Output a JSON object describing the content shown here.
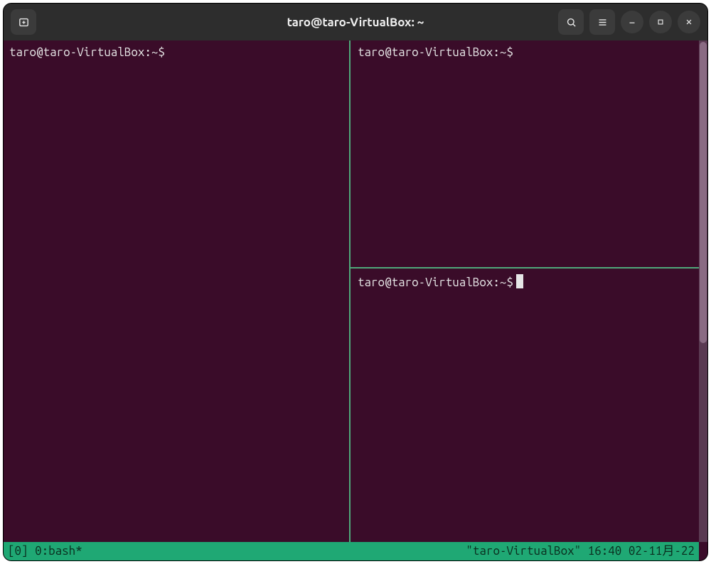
{
  "titlebar": {
    "title": "taro@taro-VirtualBox: ~"
  },
  "panes": {
    "left": {
      "prompt": "taro@taro-VirtualBox:~$"
    },
    "top_right": {
      "prompt": "taro@taro-VirtualBox:~$"
    },
    "bottom_right": {
      "prompt": "taro@taro-VirtualBox:~$"
    }
  },
  "statusbar": {
    "left": "[0] 0:bash*",
    "right": "\"taro-VirtualBox\" 16:40 02-11月-22"
  },
  "colors": {
    "terminal_bg": "#3a0c29",
    "split_line": "#4fa97a",
    "status_bg": "#1fa874"
  }
}
